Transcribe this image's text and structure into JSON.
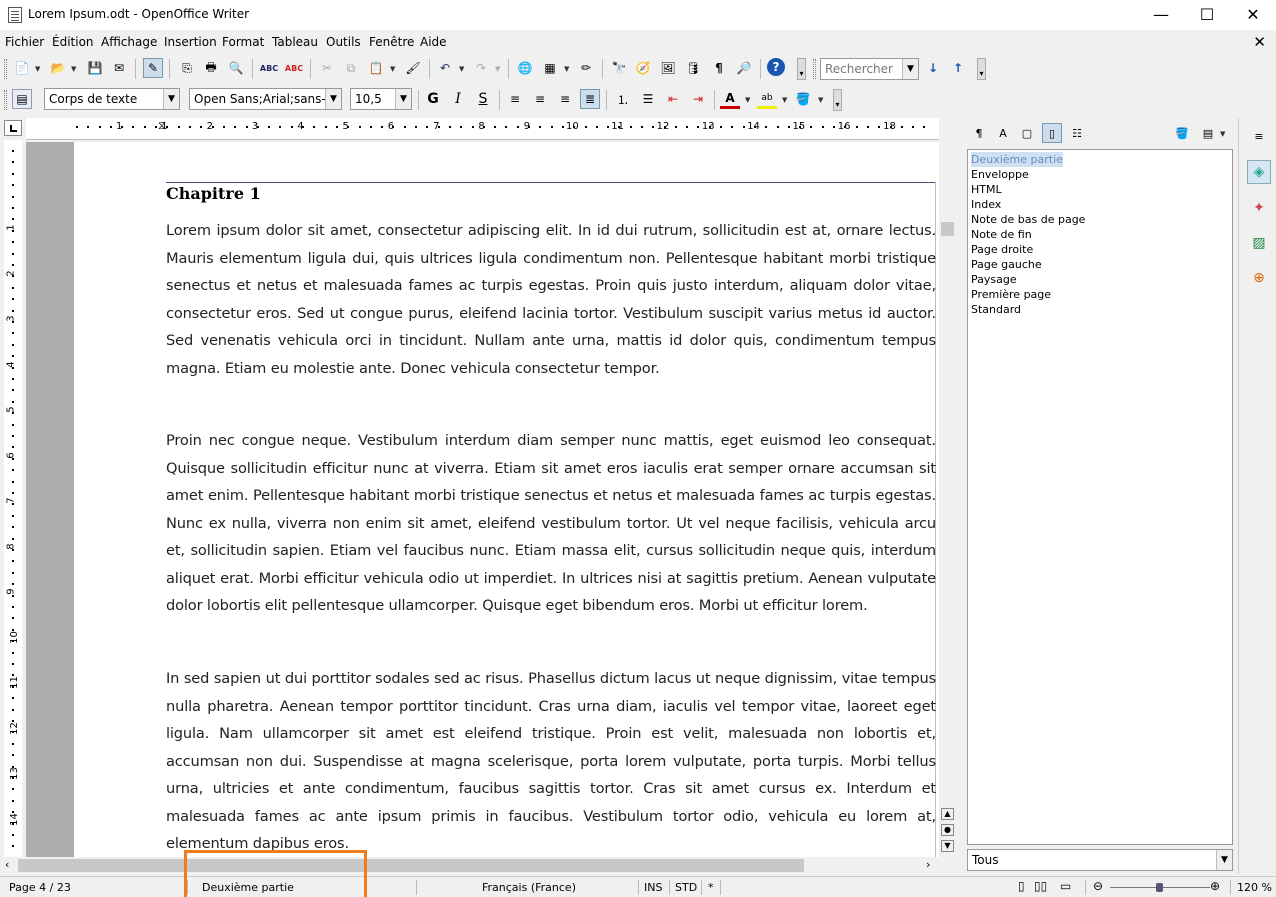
{
  "window": {
    "title": "Lorem Ipsum.odt - OpenOffice Writer",
    "minimize": "—",
    "maximize": "☐",
    "close": "✕"
  },
  "menu": {
    "items": [
      "Fichier",
      "Édition",
      "Affichage",
      "Insertion",
      "Format",
      "Tableau",
      "Outils",
      "Fenêtre",
      "Aide"
    ],
    "close_doc": "✕"
  },
  "toolbar1": {
    "search_placeholder": "Rechercher"
  },
  "toolbar2": {
    "paragraph_style": "Corps de texte",
    "font_name": "Open Sans;Arial;sans-seri",
    "font_size": "10,5"
  },
  "ruler": {
    "h_numbers": [
      "1",
      "1",
      "2",
      "3",
      "4",
      "5",
      "6",
      "7",
      "8",
      "9",
      "10",
      "11",
      "12",
      "13",
      "14",
      "15",
      "16",
      "18"
    ],
    "v_numbers": [
      "1",
      "2",
      "3",
      "4",
      "5",
      "6",
      "7",
      "8",
      "9",
      "10",
      "11",
      "12",
      "13",
      "14"
    ]
  },
  "document": {
    "chapter_title": "Chapitre 1",
    "paragraphs": [
      "Lorem ipsum dolor sit amet, consectetur adipiscing elit. In id dui rutrum, sollicitudin est at, ornare lectus. Mauris elementum ligula dui, quis ultrices ligula condimentum non. Pellentesque habitant morbi tristique senectus et netus et malesuada fames ac turpis egestas. Proin quis justo interdum, aliquam dolor vitae, consectetur eros. Sed ut congue purus, eleifend lacinia tortor. Vestibulum suscipit varius metus id auctor. Sed venenatis vehicula orci in tincidunt. Nullam ante urna, mattis id dolor quis, condimentum tempus magna. Etiam eu molestie ante. Donec vehicula consectetur tempor.",
      "Proin nec congue neque. Vestibulum interdum diam semper nunc mattis, eget euismod leo consequat. Quisque sollicitudin efficitur nunc at viverra. Etiam sit amet eros iaculis erat semper ornare accumsan sit amet enim. Pellentesque habitant morbi tristique senectus et netus et malesuada fames ac turpis egestas. Nunc ex nulla, viverra non enim sit amet, eleifend vestibulum tortor. Ut vel neque facilisis, vehicula arcu et, sollicitudin sapien. Etiam vel faucibus nunc. Etiam massa elit, cursus sollicitudin neque quis, interdum aliquet erat. Morbi efficitur vehicula odio ut imperdiet. In ultrices nisi at sagittis pretium. Aenean vulputate dolor lobortis elit pellentesque ullamcorper. Quisque eget bibendum eros. Morbi ut efficitur lorem.",
      "In sed sapien ut dui porttitor sodales sed ac risus. Phasellus dictum lacus ut neque dignissim, vitae tempus nulla pharetra. Aenean tempor porttitor tincidunt. Cras urna diam, iaculis vel tempor vitae, laoreet eget ligula. Nam ullamcorper sit amet est eleifend tristique. Proin est velit, malesuada non lobortis et, accumsan non dui. Suspendisse at magna scelerisque, porta lorem vulputate, porta turpis. Morbi tellus urna, ultricies et ante condimentum, faucibus sagittis tortor. Cras sit amet cursus ex. Interdum et malesuada fames ac ante ipsum primis in faucibus. Vestibulum tortor odio, vehicula eu lorem at, elementum dapibus eros."
    ]
  },
  "styles_panel": {
    "items": [
      "Deuxième partie",
      "Enveloppe",
      "HTML",
      "Index",
      "Note de bas de page",
      "Note de fin",
      "Page droite",
      "Page gauche",
      "Paysage",
      "Première page",
      "Standard"
    ],
    "selected": "Deuxième partie",
    "filter": "Tous"
  },
  "status": {
    "page": "Page 4 / 23",
    "page_style": "Deuxième partie",
    "language": "Français (France)",
    "insert_mode": "INS",
    "selection_mode": "STD",
    "modified": "*",
    "zoom": "120 %",
    "zoom_level_percent": 120
  },
  "colors": {
    "highlight": "#ee7d1a",
    "selected_bg": "#cfe0f5"
  }
}
